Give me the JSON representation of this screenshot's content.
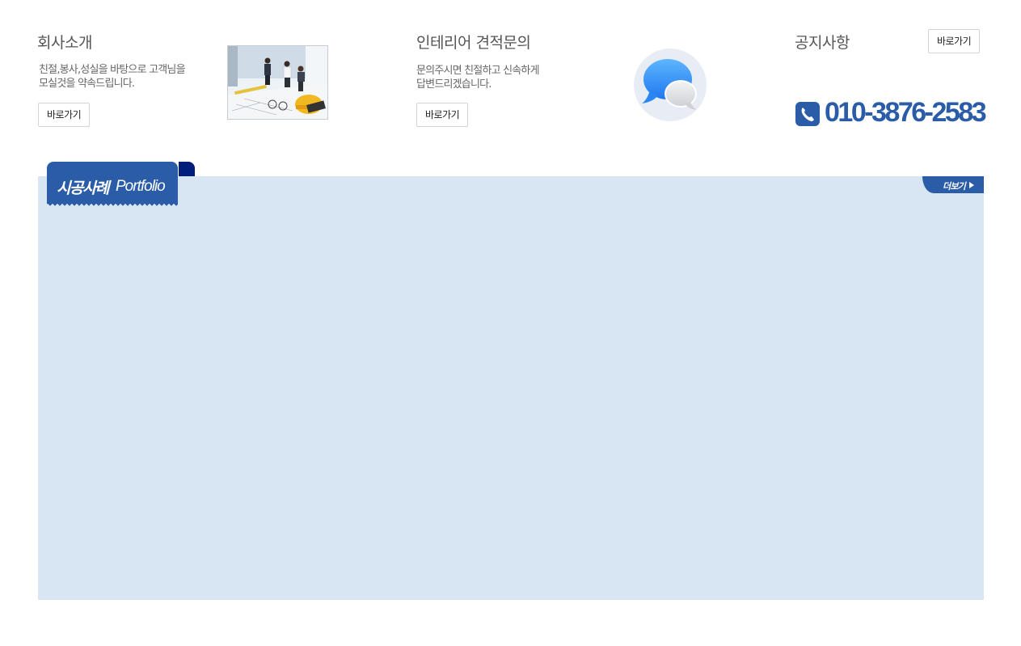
{
  "company": {
    "title": "회사소개",
    "desc_line1": "친절,봉사,성실을 바탕으로 고객님을",
    "desc_line2": "모실것을 약속드립니다.",
    "button": "바로가기"
  },
  "inquiry": {
    "title": "인테리어 견적문의",
    "desc_line1": "문의주시면 친절하고 신속하게",
    "desc_line2": "답변드리겠습니다.",
    "button": "바로가기"
  },
  "notice": {
    "title": "공지사항",
    "button": "바로가기",
    "phone": "010-3876-2583"
  },
  "portfolio": {
    "title_ko": "시공사례",
    "title_en": "Portfolio",
    "more": "더보기"
  },
  "colors": {
    "brand_blue": "#2a5ca8",
    "panel_bg": "#d8e6f3",
    "fold_navy": "#001e7a"
  },
  "icons": [
    "people-photo",
    "chat-bubbles-icon",
    "phone-icon",
    "arrow-right-icon"
  ]
}
